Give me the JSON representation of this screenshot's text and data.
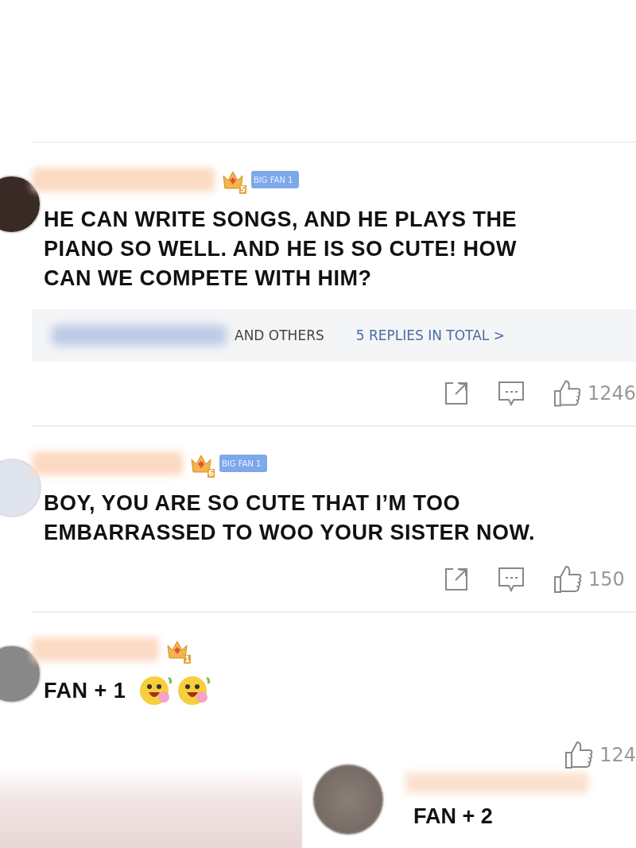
{
  "comments": [
    {
      "badge": {
        "level": "5",
        "label": "BIG FAN 1"
      },
      "text": "HE CAN WRITE SONGS, AND HE PLAYS THE PIANO SO WELL. AND HE IS SO CUTE! HOW CAN WE COMPETE WITH HIM?",
      "replies": {
        "summary": "AND OTHERS",
        "link": "5 REPLIES IN TOTAL >"
      },
      "likes": "1246"
    },
    {
      "badge": {
        "level": "6",
        "label": "BIG FAN 1"
      },
      "text": "BOY, YOU ARE SO CUTE THAT I’M TOO EMBARRASSED TO WOO YOUR SISTER NOW.",
      "likes": "150"
    },
    {
      "badge": {
        "level": "1"
      },
      "text": "FAN + 1",
      "emojis": [
        {
          "kind": "smiley"
        },
        {
          "kind": "smiley"
        }
      ]
    }
  ],
  "overlay": {
    "likes": "124",
    "text": "FAN + 2"
  }
}
